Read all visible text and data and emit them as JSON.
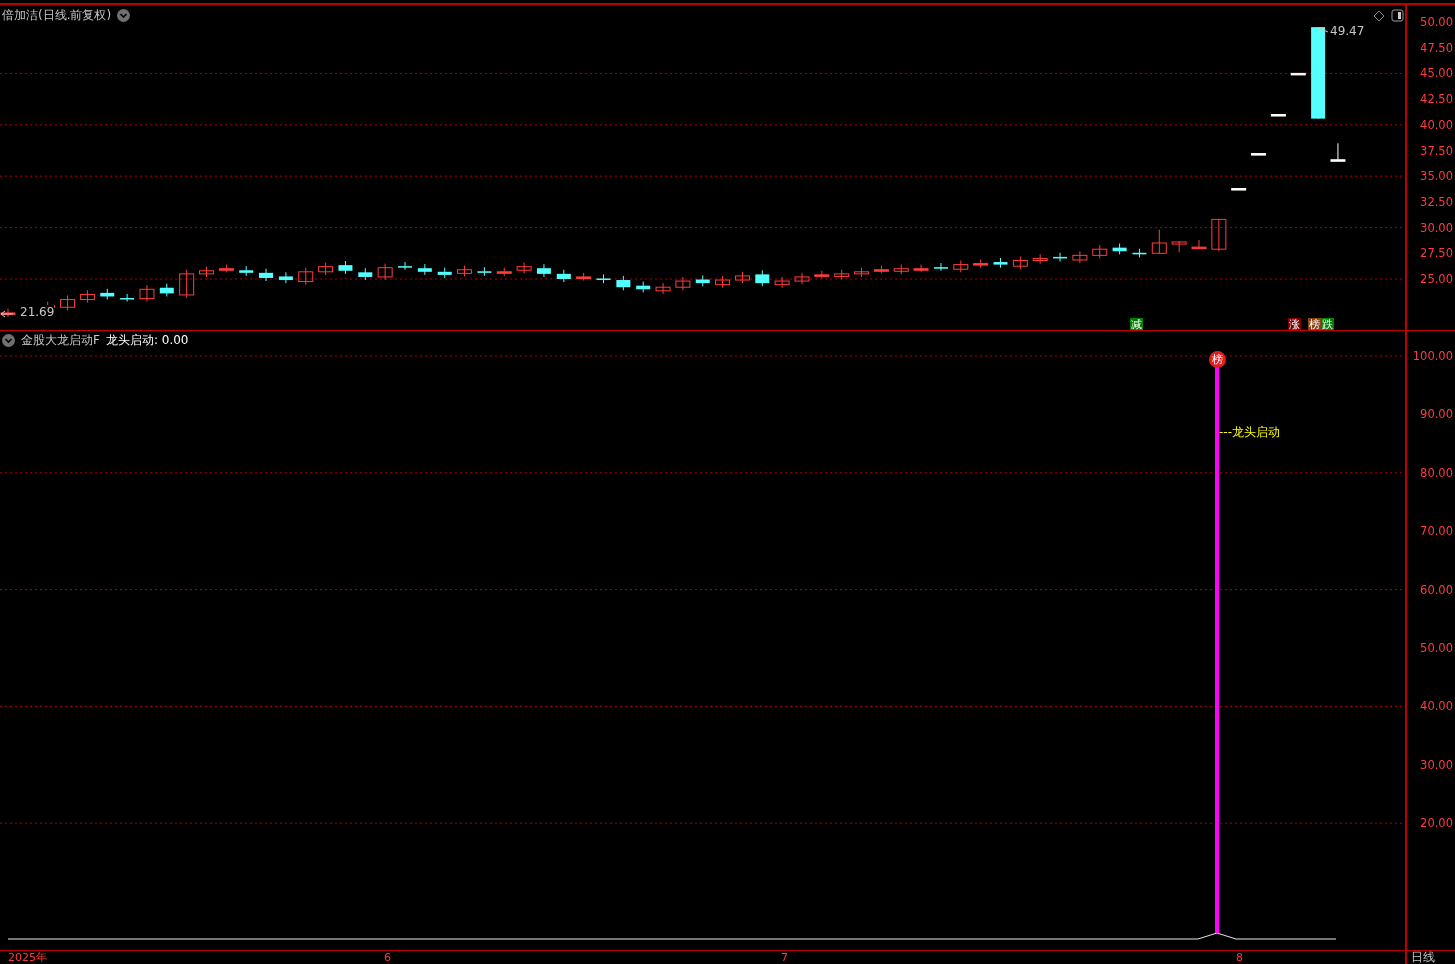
{
  "price_panel": {
    "title": "倍加洁(日线.前复权)",
    "high_label": "49.47",
    "low_label": "21.69",
    "signals": [
      {
        "text": "减",
        "color": "#008000"
      },
      {
        "text": "涨",
        "color": "#800000"
      },
      {
        "text": "榜",
        "color": "#8b4513"
      },
      {
        "text": "跌",
        "color": "#008000"
      }
    ]
  },
  "price_axis": {
    "labels": [
      "50.00",
      "47.50",
      "45.00",
      "42.50",
      "40.00",
      "37.50",
      "35.00",
      "32.50",
      "30.00",
      "27.50",
      "25.00"
    ]
  },
  "indicator_panel": {
    "name": "金股大龙启动F",
    "reading": "龙头启动: 0.00",
    "badge": "榜",
    "line_label": "---龙头启动"
  },
  "indicator_axis": {
    "labels": [
      "100.00",
      "90.00",
      "80.00",
      "70.00",
      "60.00",
      "50.00",
      "40.00",
      "30.00",
      "20.00"
    ]
  },
  "time_axis": {
    "labels": [
      "2025年",
      "6",
      "7",
      "8"
    ],
    "period": "日线"
  }
}
